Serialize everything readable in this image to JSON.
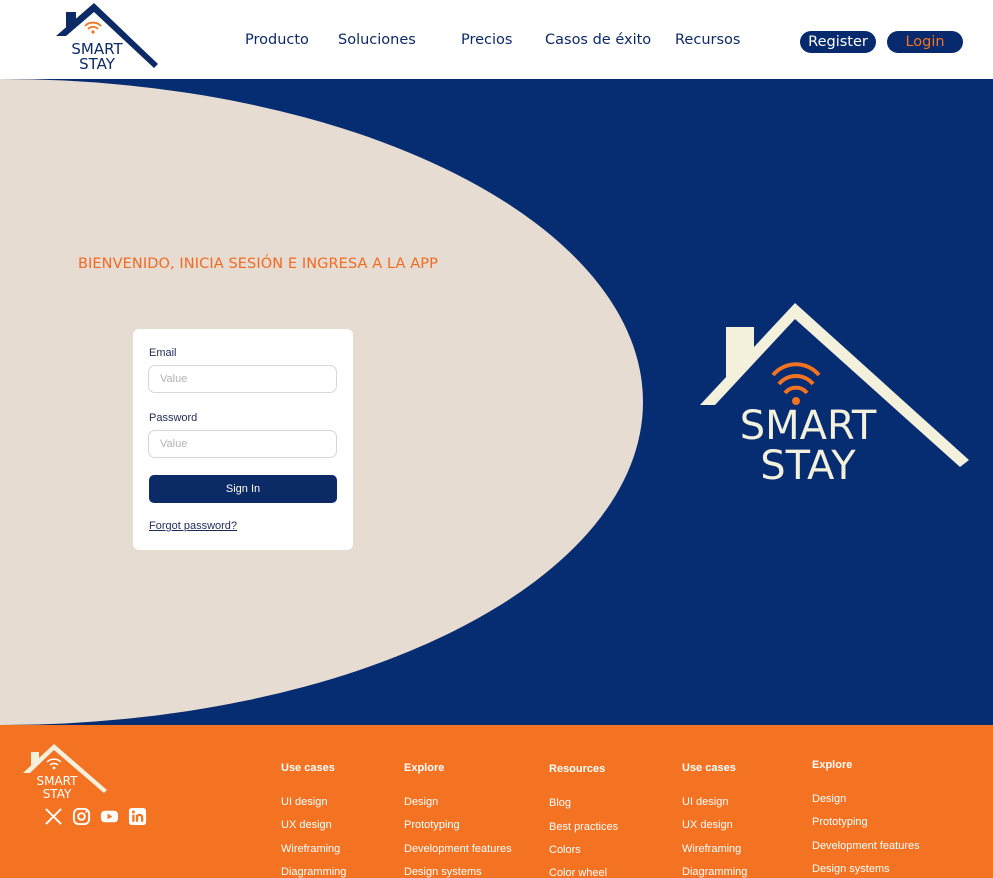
{
  "brand": {
    "line1": "SMART",
    "line2": "STAY"
  },
  "nav": {
    "items": [
      "Producto",
      "Soluciones",
      "Precios",
      "Casos de éxito",
      "Recursos"
    ],
    "register_label": "Register",
    "login_label": "Login"
  },
  "hero": {
    "welcome": "BIENVENIDO, INICIA SESIÓN E INGRESA A LA APP"
  },
  "login_form": {
    "email_label": "Email",
    "email_placeholder": "Value",
    "password_label": "Password",
    "password_placeholder": "Value",
    "sign_in_label": "Sign In",
    "forgot_label": "Forgot password?"
  },
  "footer": {
    "social_icons": [
      "x-icon",
      "instagram-icon",
      "youtube-icon",
      "linkedin-icon"
    ],
    "columns": [
      {
        "title": "Use cases",
        "links": [
          "UI design",
          "UX design",
          "Wireframing",
          "Diagramming"
        ]
      },
      {
        "title": "Explore",
        "links": [
          "Design",
          "Prototyping",
          "Development features",
          "Design systems"
        ]
      },
      {
        "title": "Resources",
        "links": [
          "Blog",
          "Best practices",
          "Colors",
          "Color wheel"
        ]
      },
      {
        "title": "Use cases",
        "links": [
          "UI design",
          "UX design",
          "Wireframing",
          "Diagramming"
        ]
      },
      {
        "title": "Explore",
        "links": [
          "Design",
          "Prototyping",
          "Development features",
          "Design systems"
        ]
      }
    ]
  },
  "colors": {
    "navy": "#062c72",
    "orange": "#f47322",
    "beige": "#e6dcd1",
    "cream": "#f3f0dc"
  }
}
